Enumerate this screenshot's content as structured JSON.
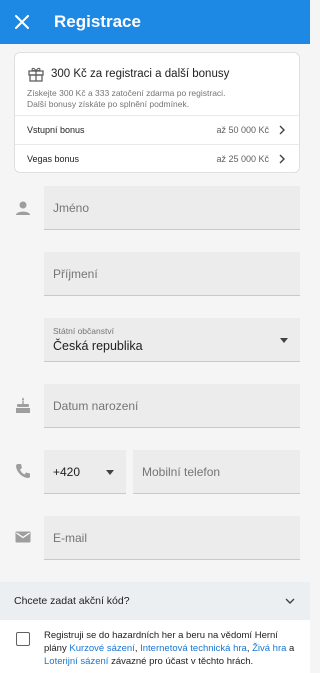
{
  "header": {
    "title": "Registrace"
  },
  "bonus": {
    "title": "300 Kč za registraci a další bonusy",
    "desc_line1": "Získejte 300 Kč a 333 zatočení zdarma po registraci.",
    "desc_line2": "Další bonusy získáte po splnění podmínek.",
    "rows": [
      {
        "name": "Vstupní bonus",
        "amount": "až 50 000 Kč"
      },
      {
        "name": "Vegas bonus",
        "amount": "až 25 000 Kč"
      }
    ]
  },
  "form": {
    "first_name_placeholder": "Jméno",
    "last_name_placeholder": "Příjmení",
    "citizenship_label": "Státní občanství",
    "citizenship_value": "Česká republika",
    "birthdate_placeholder": "Datum narození",
    "phone_prefix": "+420",
    "phone_placeholder": "Mobilní telefon",
    "email_placeholder": "E-mail"
  },
  "promo": {
    "label": "Chcete zadat akční kód?"
  },
  "consent": {
    "t1": "Registruji se do hazardních her a beru na vědomí Herní plány ",
    "l1": "Kurzové sázení",
    "t2": ", ",
    "l2": "Internetová technická hra",
    "t3": ", ",
    "l3": "Živá hra",
    "t4": " a ",
    "l4": "Loterijní sázení",
    "t5": " závazné pro účast v těchto hrách."
  },
  "colors": {
    "accent": "#1e88e5",
    "link": "#1976d2"
  }
}
